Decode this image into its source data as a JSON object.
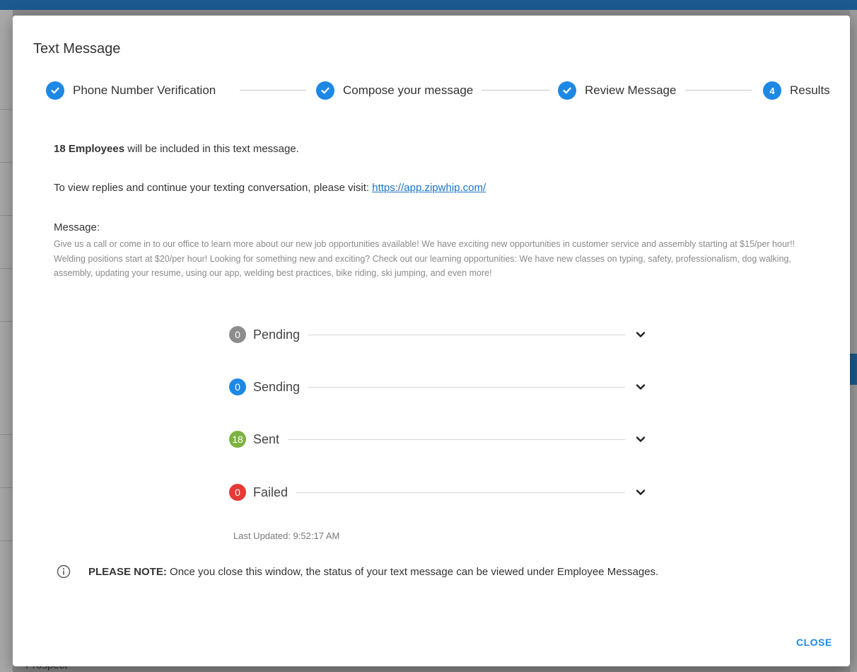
{
  "background": {
    "bottom_label": "Prospect"
  },
  "modal": {
    "title": "Text Message",
    "steps": [
      {
        "label": "Phone Number Verification",
        "state": "complete"
      },
      {
        "label": "Compose your message",
        "state": "complete"
      },
      {
        "label": "Review Message",
        "state": "complete"
      },
      {
        "label": "Results",
        "state": "active",
        "number": "4"
      }
    ],
    "included": {
      "count_label": "18 Employees",
      "suffix": " will be included in this text message."
    },
    "replies": {
      "prefix": "To view replies and continue your texting conversation, please visit: ",
      "link": "https://app.zipwhip.com/"
    },
    "message": {
      "heading": "Message:",
      "body": "Give us a call or come in to our office to learn more about our new job opportunities available! We have exciting new opportunities in customer service and assembly starting at $15/per hour!! Welding positions start at $20/per hour! Looking for something new and exciting? Check out our learning opportunities: We have new classes on typing, safety, professionalism, dog walking, assembly, updating your resume, using our app, welding best practices, bike riding, ski jumping, and even more!"
    },
    "statuses": [
      {
        "count": "0",
        "label": "Pending",
        "color": "#8d8d8d"
      },
      {
        "count": "0",
        "label": "Sending",
        "color": "#1e88e5"
      },
      {
        "count": "18",
        "label": "Sent",
        "color": "#7cb342"
      },
      {
        "count": "0",
        "label": "Failed",
        "color": "#e53935"
      }
    ],
    "last_updated": "Last Updated: 9:52:17 AM",
    "note": {
      "label": "PLEASE NOTE:",
      "text": " Once you close this window, the status of your text message can be viewed under Employee Messages."
    },
    "close_label": "CLOSE"
  },
  "colors": {
    "accent": "#1e88e5",
    "link": "#1a73c8",
    "topbar": "#1c5a8f"
  }
}
